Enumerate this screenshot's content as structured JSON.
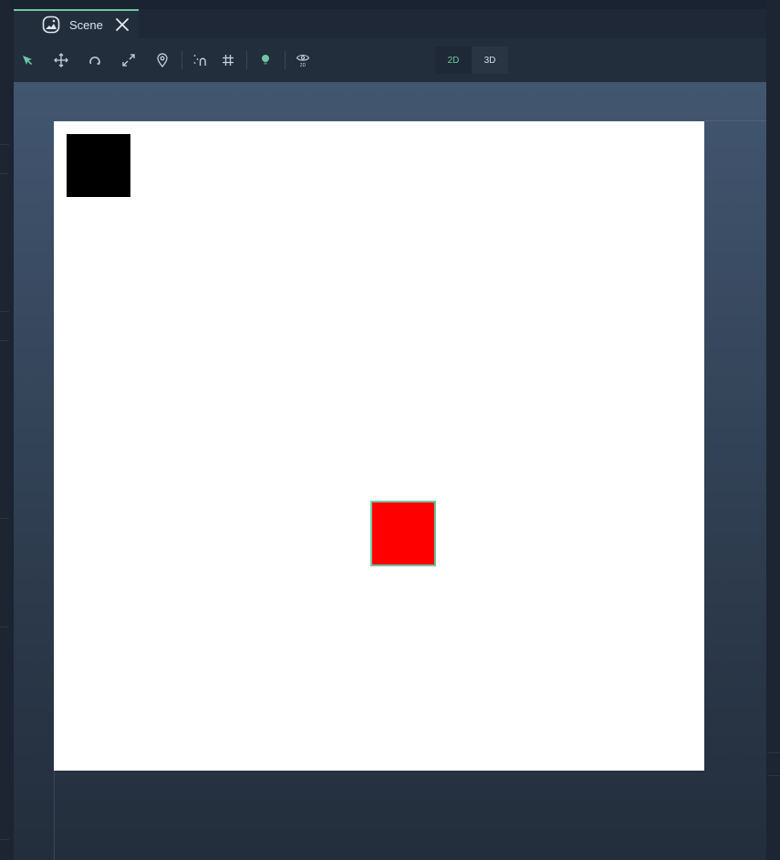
{
  "tab": {
    "label": "Scene",
    "icon": "scene-icon",
    "close_icon": "close-icon"
  },
  "toolbar": {
    "tools": [
      {
        "name": "select-tool",
        "icon": "cursor-arrow-icon",
        "active": true
      },
      {
        "name": "move-tool",
        "icon": "move-arrows-icon"
      },
      {
        "name": "rotate-tool",
        "icon": "rotate-icon"
      },
      {
        "name": "scale-tool",
        "icon": "expand-icon"
      },
      {
        "name": "pivot-tool",
        "icon": "location-pin-icon"
      },
      {
        "name": "snap-tool",
        "icon": "snap-magnet-icon"
      },
      {
        "name": "grid-tool",
        "icon": "grid-hash-icon"
      },
      {
        "name": "lighting-toggle",
        "icon": "lightbulb-icon"
      },
      {
        "name": "view-2d-toggle",
        "icon": "eye-2d-icon"
      }
    ],
    "mode_2d": "2D",
    "mode_3d": "3D",
    "active_mode": "2D"
  },
  "colors": {
    "accent": "#6fc7a1",
    "panel": "#232e3c",
    "black_sprite": "#000000",
    "red_sprite": "#ff0000",
    "canvas": "#ffffff"
  }
}
